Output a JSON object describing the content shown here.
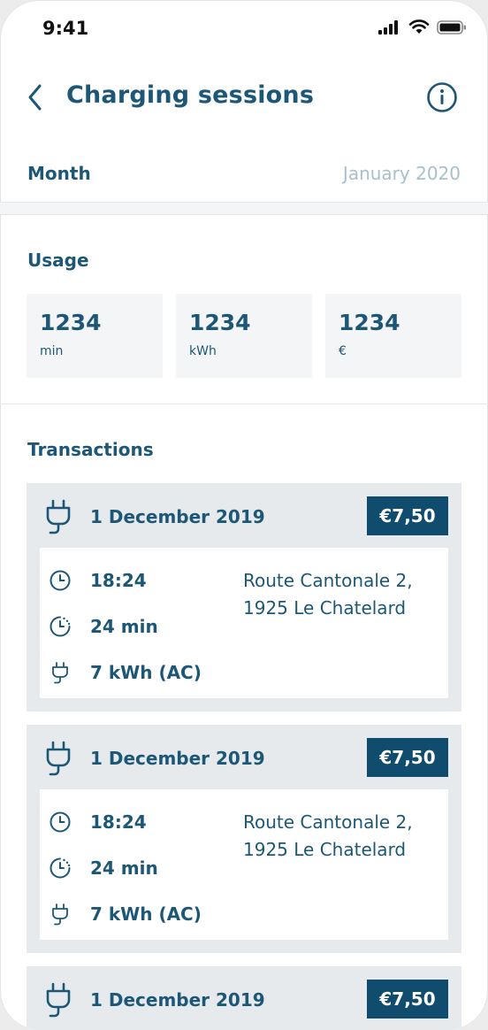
{
  "status_bar": {
    "time": "9:41"
  },
  "header": {
    "title": "Charging sessions"
  },
  "month": {
    "label": "Month",
    "value": "January 2020"
  },
  "usage": {
    "heading": "Usage",
    "cards": [
      {
        "value": "1234",
        "unit": "min"
      },
      {
        "value": "1234",
        "unit": "kWh"
      },
      {
        "value": "1234",
        "unit": "€"
      }
    ]
  },
  "transactions": {
    "heading": "Transactions",
    "items": [
      {
        "date": "1 December 2019",
        "price": "€7,50",
        "time": "18:24",
        "duration": "24 min",
        "energy": "7 kWh (AC)",
        "address_line1": "Route Cantonale 2,",
        "address_line2": "1925 Le Chatelard"
      },
      {
        "date": "1 December 2019",
        "price": "€7,50",
        "time": "18:24",
        "duration": "24 min",
        "energy": "7 kWh (AC)",
        "address_line1": "Route Cantonale 2,",
        "address_line2": "1925 Le Chatelard"
      },
      {
        "date": "1 December 2019",
        "price": "€7,50"
      }
    ]
  },
  "colors": {
    "primary": "#0f4c6d",
    "text": "#1d5777",
    "muted": "#a9bfcb",
    "card_bg": "#e7eaec"
  }
}
